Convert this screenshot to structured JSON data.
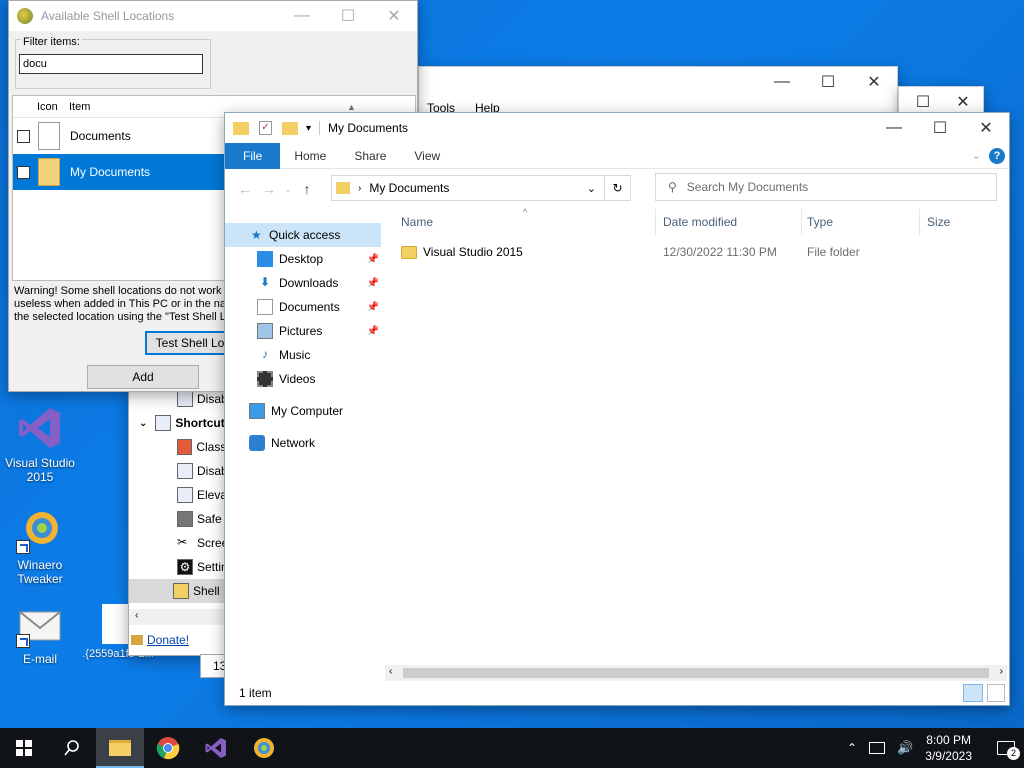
{
  "desktop": {
    "icons": [
      {
        "label": "Visual Studio 2015"
      },
      {
        "label": "Winaero Tweaker"
      },
      {
        "label": "E-mail"
      },
      {
        "label": ".{2559a1f5-2..."
      }
    ]
  },
  "behind_window": {
    "menu": [
      "Tools",
      "Help"
    ]
  },
  "winaero": {
    "items": [
      {
        "label": "Disab"
      },
      {
        "label": "Shortcut"
      },
      {
        "label": "Classi"
      },
      {
        "label": "Disab"
      },
      {
        "label": "Eleva"
      },
      {
        "label": "Safe"
      },
      {
        "label": "Scree"
      },
      {
        "label": "Settin"
      },
      {
        "label": "Shell"
      }
    ],
    "donate": "Donate!",
    "partial": "13"
  },
  "dialog": {
    "title": "Available Shell Locations",
    "filter_label": "Filter items:",
    "filter_value": "docu",
    "col_icon": "Icon",
    "col_item": "Item",
    "rows": [
      {
        "label": "Documents",
        "selected": false
      },
      {
        "label": "My Documents",
        "selected": true
      }
    ],
    "warning": [
      "Warning! Some shell locations do not work in",
      "useless when added in This PC or in the nav",
      "the selected location using the \"Test Shell Lo"
    ],
    "test_button": "Test Shell Lo",
    "add_button": "Add"
  },
  "explorer": {
    "title": "My Documents",
    "ribbon_tabs": [
      "File",
      "Home",
      "Share",
      "View"
    ],
    "address": "My Documents",
    "search_placeholder": "Search My Documents",
    "nav": {
      "quick_access": "Quick access",
      "items": [
        "Desktop",
        "Downloads",
        "Documents",
        "Pictures",
        "Music",
        "Videos"
      ],
      "my_computer": "My Computer",
      "network": "Network"
    },
    "columns": [
      "Name",
      "Date modified",
      "Type",
      "Size"
    ],
    "files": [
      {
        "name": "Visual Studio 2015",
        "modified": "12/30/2022 11:30 PM",
        "type": "File folder",
        "size": ""
      }
    ],
    "status": "1 item"
  },
  "taskbar": {
    "time": "8:00 PM",
    "date": "3/9/2023",
    "notifications": "2"
  },
  "colors": {
    "accent": "#0078d7",
    "file_tab": "#1979ca",
    "desktop": "#0a6fd6"
  }
}
